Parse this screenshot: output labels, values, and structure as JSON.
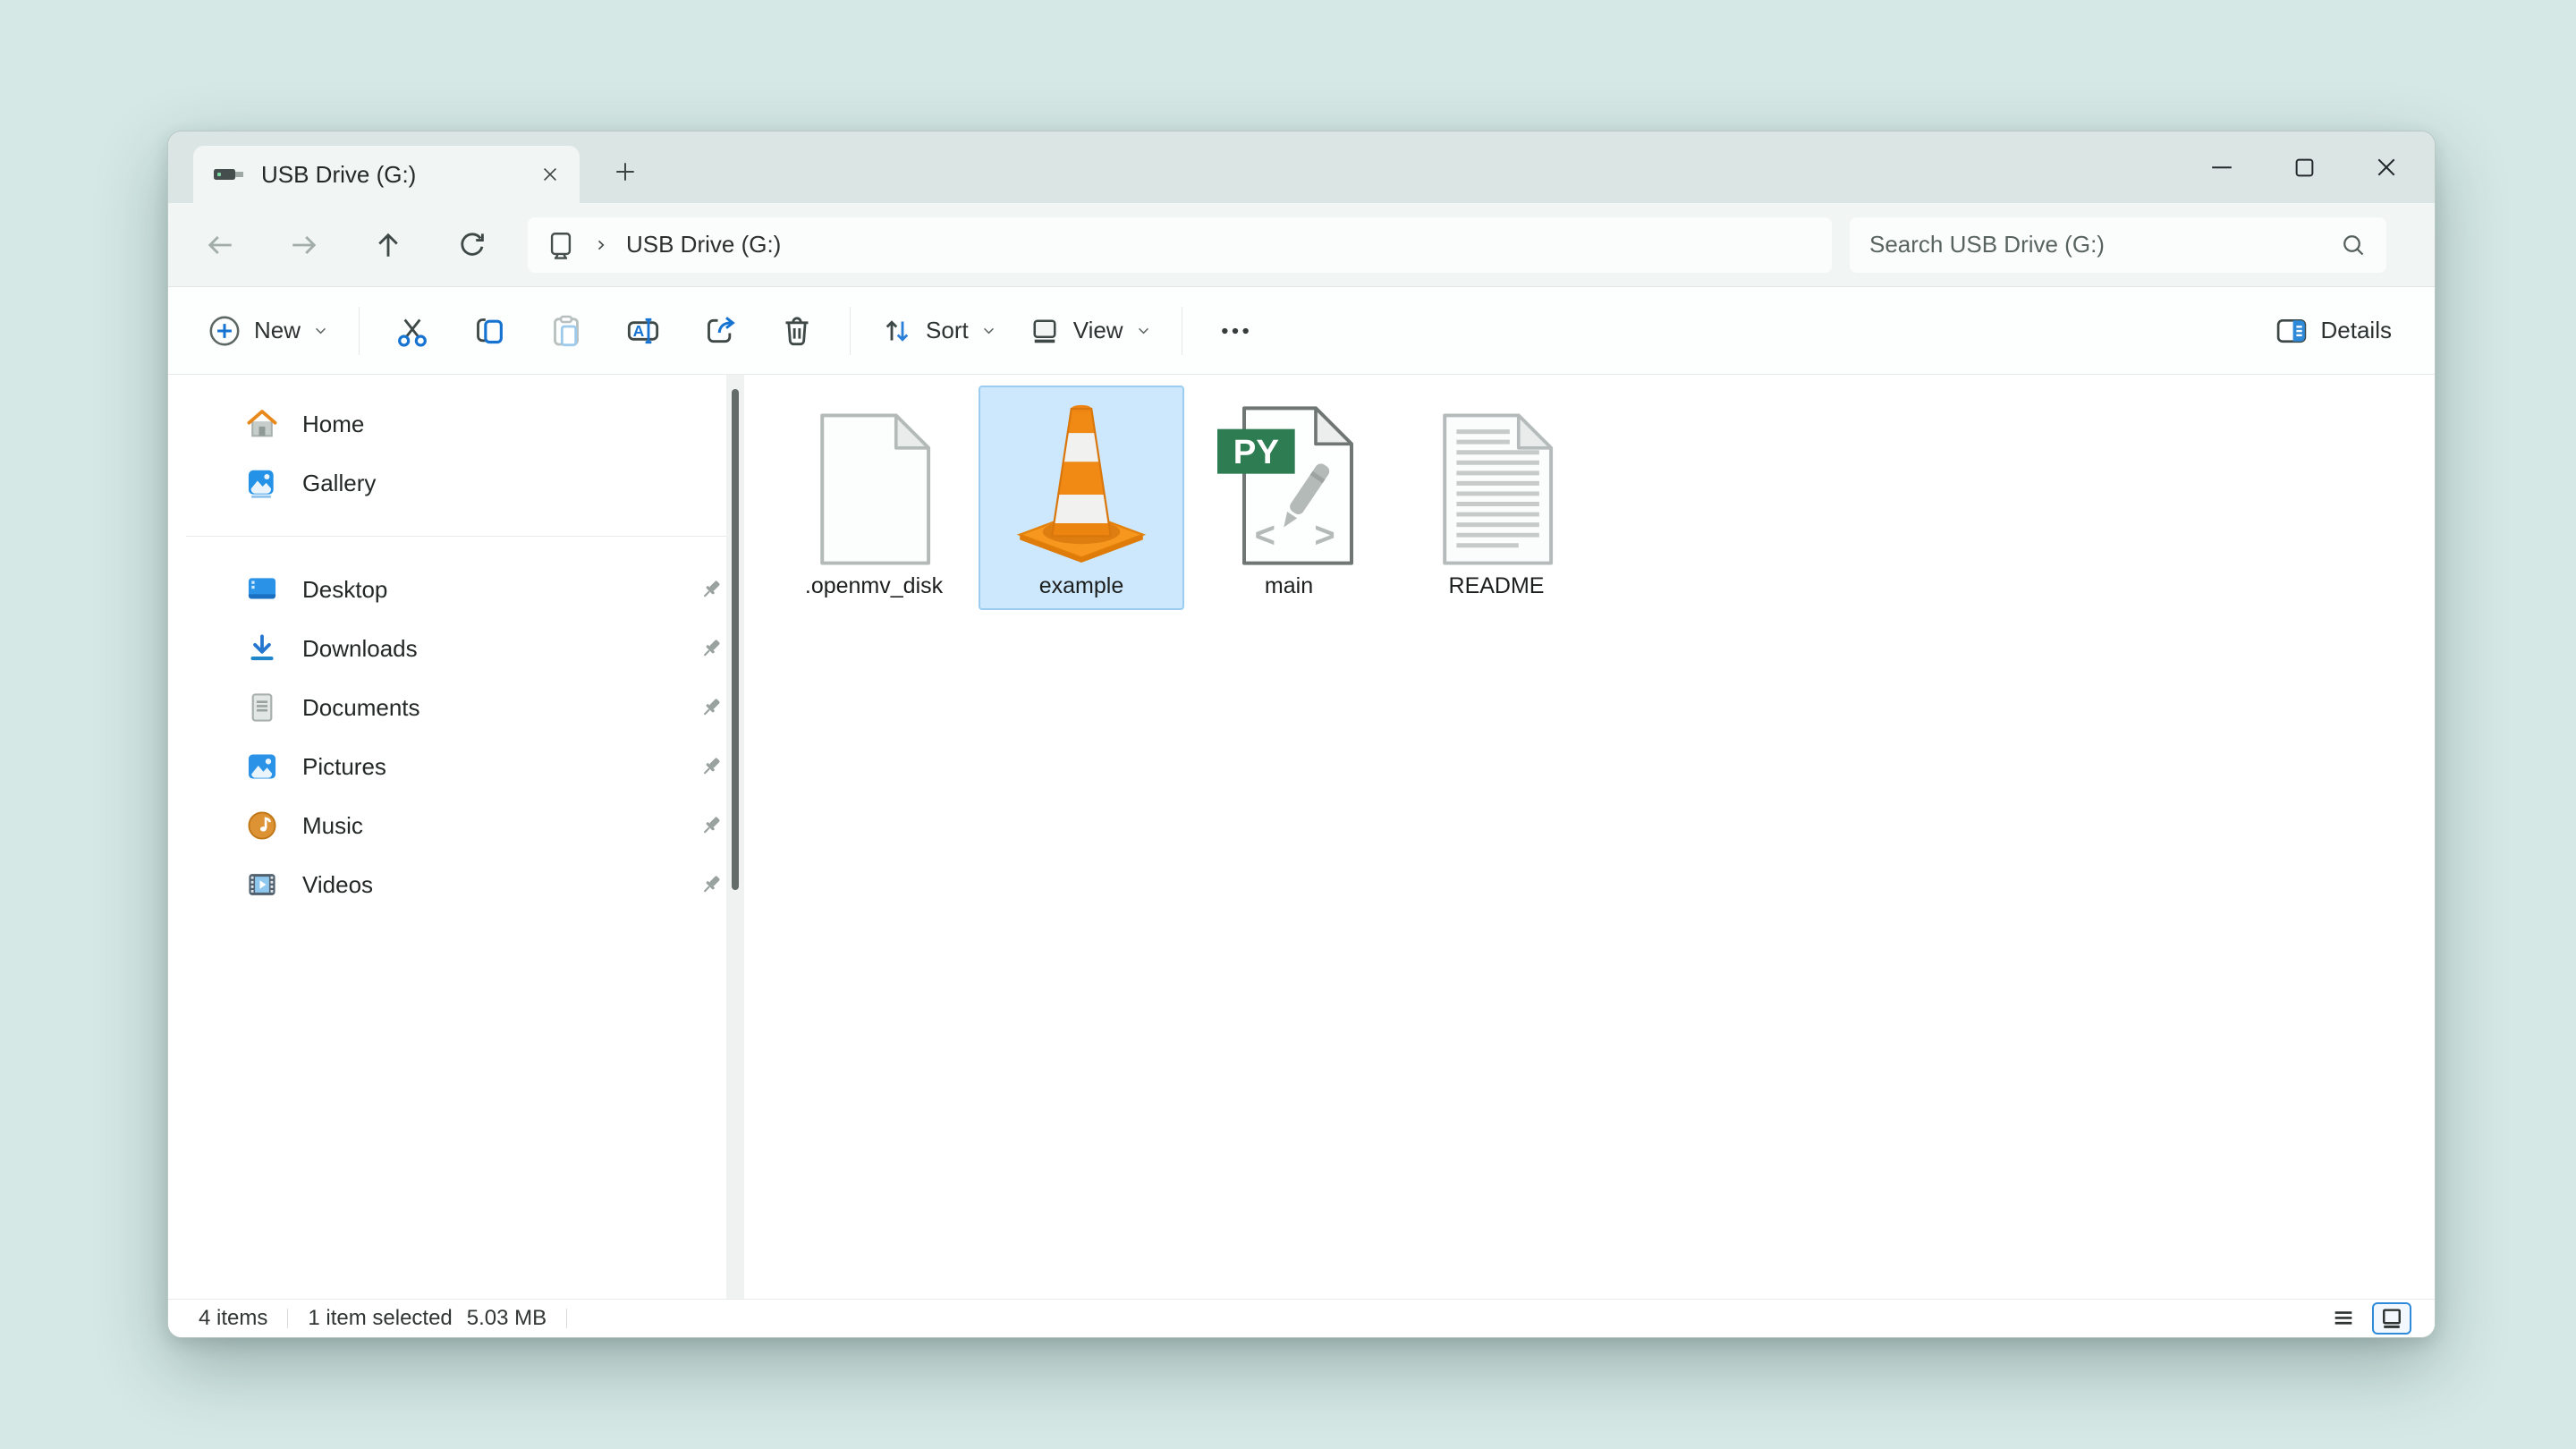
{
  "tabbar": {
    "title": "USB Drive (G:)"
  },
  "navbar": {
    "breadcrumb_root_icon": "monitor-icon",
    "breadcrumb": "USB Drive (G:)",
    "search_placeholder": "Search USB Drive (G:)"
  },
  "toolbar": {
    "new_label": "New",
    "sort_label": "Sort",
    "view_label": "View",
    "details_label": "Details"
  },
  "sidebar": {
    "items": [
      {
        "label": "Home",
        "icon": "home-icon"
      },
      {
        "label": "Gallery",
        "icon": "gallery-icon"
      }
    ],
    "pinned": [
      {
        "label": "Desktop",
        "icon": "desktop-icon",
        "pinned": true
      },
      {
        "label": "Downloads",
        "icon": "downloads-icon",
        "pinned": true
      },
      {
        "label": "Documents",
        "icon": "documents-icon",
        "pinned": true
      },
      {
        "label": "Pictures",
        "icon": "pictures-icon",
        "pinned": true
      },
      {
        "label": "Music",
        "icon": "music-icon",
        "pinned": true
      },
      {
        "label": "Videos",
        "icon": "videos-icon",
        "pinned": true
      }
    ]
  },
  "files": [
    {
      "name": ".openmv_disk",
      "icon": "blank-document-icon",
      "selected": false
    },
    {
      "name": "example",
      "icon": "vlc-cone-icon",
      "selected": true
    },
    {
      "name": "main",
      "icon": "python-file-icon",
      "selected": false
    },
    {
      "name": "README",
      "icon": "text-document-icon",
      "selected": false
    }
  ],
  "statusbar": {
    "items_count": "4 items",
    "selection_count": "1 item selected",
    "selection_size": "5.03 MB"
  },
  "colors": {
    "accent_blue": "#1673d1",
    "selection_bg": "#cde8fc",
    "selection_border": "#9bcdf1",
    "page_bg": "#d5e8e5",
    "titlebar_bg": "#dbe5e3",
    "python_badge_green": "#2e7d52",
    "vlc_orange": "#f18a15"
  }
}
